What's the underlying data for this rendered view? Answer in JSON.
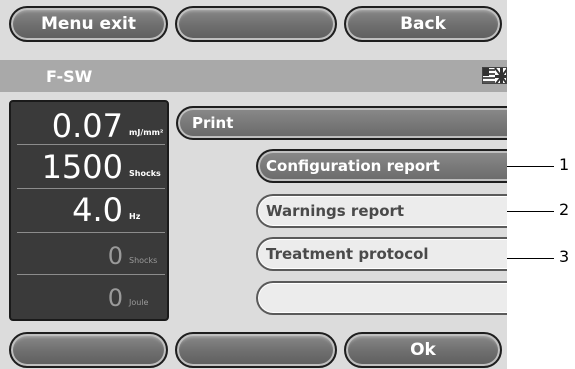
{
  "top_buttons": {
    "left_label": "Menu exit",
    "middle_label": "",
    "right_label": "Back"
  },
  "title_bar": {
    "title": "F-SW",
    "language_flag_icon": "us-uk-flag-icon"
  },
  "parameters": [
    {
      "value": "0.07",
      "unit": "mJ/mm²",
      "active": true
    },
    {
      "value": "1500",
      "unit": "Shocks",
      "active": true
    },
    {
      "value": "4.0",
      "unit": "Hz",
      "active": true
    },
    {
      "value": "0",
      "unit": "Shocks",
      "active": false
    },
    {
      "value": "0",
      "unit": "Joule",
      "active": false
    }
  ],
  "print_menu": {
    "header": "Print",
    "items": [
      {
        "label": "Configuration report",
        "selected": true
      },
      {
        "label": "Warnings report",
        "selected": false
      },
      {
        "label": "Treatment protocol",
        "selected": false
      },
      {
        "label": "",
        "selected": false
      }
    ]
  },
  "bottom_buttons": {
    "left_label": "",
    "middle_label": "",
    "right_label": "Ok"
  },
  "callouts": [
    "1",
    "2",
    "3"
  ],
  "colors": {
    "button_gray": "#6e6e6e",
    "screen_background": "#dcdcdc",
    "title_bar": "#a9a9a9",
    "param_panel": "#3a3a3a"
  }
}
